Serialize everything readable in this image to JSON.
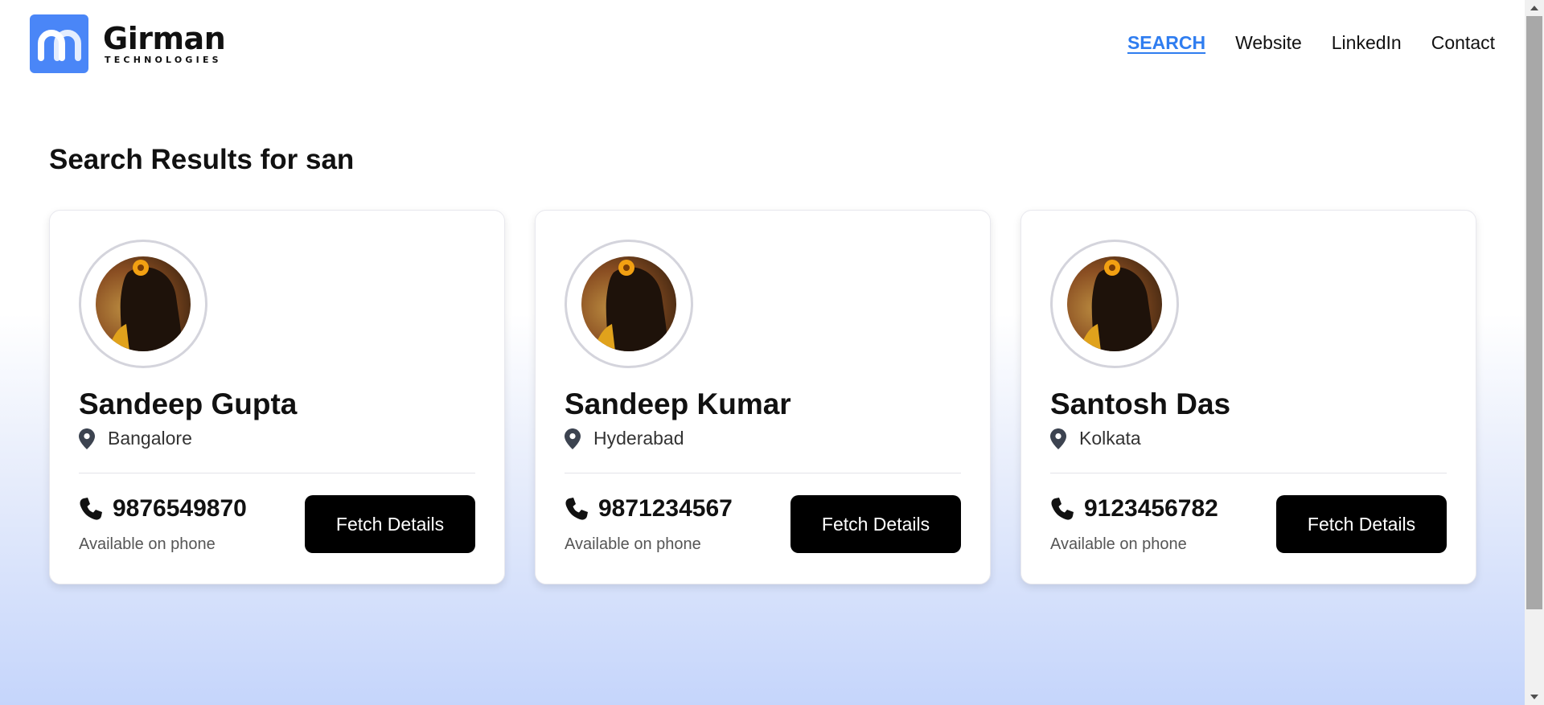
{
  "brand": {
    "name": "Girman",
    "subtitle": "TECHNOLOGIES",
    "color": "#4a86f7"
  },
  "nav": {
    "items": [
      {
        "label": "SEARCH",
        "active": true
      },
      {
        "label": "Website",
        "active": false
      },
      {
        "label": "LinkedIn",
        "active": false
      },
      {
        "label": "Contact",
        "active": false
      }
    ],
    "active_color": "#2f7df0"
  },
  "results": {
    "title": "Search Results for san"
  },
  "cards": [
    {
      "name": "Sandeep Gupta",
      "location": "Bangalore",
      "location_icon": "map-pin-icon",
      "phone": "9876549870",
      "phone_icon": "phone-icon",
      "availability": "Available on phone",
      "button": "Fetch Details"
    },
    {
      "name": "Sandeep Kumar",
      "location": "Hyderabad",
      "location_icon": "map-pin-icon",
      "phone": "9871234567",
      "phone_icon": "phone-icon",
      "availability": "Available on phone",
      "button": "Fetch Details"
    },
    {
      "name": "Santosh Das",
      "location": "Kolkata",
      "location_icon": "map-pin-icon",
      "phone": "9123456782",
      "phone_icon": "phone-icon",
      "availability": "Available on phone",
      "button": "Fetch Details"
    }
  ],
  "colors": {
    "button_bg": "#000000",
    "gradient_bottom": "#c5d5fb"
  }
}
